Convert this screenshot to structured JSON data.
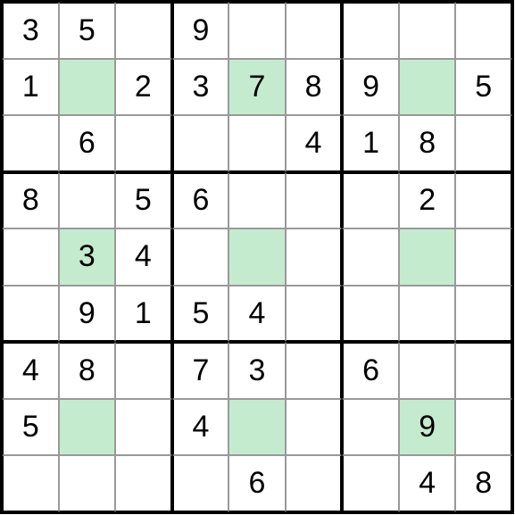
{
  "chart_data": {
    "type": "table",
    "title": "Sudoku Puzzle",
    "grid_size": 9,
    "box_size": 3,
    "rows": [
      [
        "3",
        "5",
        "",
        "9",
        "",
        "",
        "",
        "",
        ""
      ],
      [
        "1",
        "",
        "2",
        "3",
        "7",
        "8",
        "9",
        "",
        "5"
      ],
      [
        "",
        "6",
        "",
        "",
        "",
        "4",
        "1",
        "8",
        ""
      ],
      [
        "8",
        "",
        "5",
        "6",
        "",
        "",
        "",
        "2",
        ""
      ],
      [
        "",
        "3",
        "4",
        "",
        "",
        "",
        "",
        "",
        ""
      ],
      [
        "",
        "9",
        "1",
        "5",
        "4",
        "",
        "",
        "",
        ""
      ],
      [
        "4",
        "8",
        "",
        "7",
        "3",
        "",
        "6",
        "",
        ""
      ],
      [
        "5",
        "",
        "",
        "4",
        "",
        "",
        "",
        "9",
        ""
      ],
      [
        "",
        "",
        "",
        "",
        "6",
        "",
        "",
        "4",
        "8"
      ]
    ],
    "highlighted": [
      [
        1,
        1
      ],
      [
        1,
        4
      ],
      [
        1,
        7
      ],
      [
        4,
        1
      ],
      [
        4,
        4
      ],
      [
        4,
        7
      ],
      [
        7,
        1
      ],
      [
        7,
        4
      ],
      [
        7,
        7
      ]
    ],
    "highlight_color": "#c5ebce",
    "thick_border_color": "#000000",
    "thin_border_color": "#999999"
  }
}
